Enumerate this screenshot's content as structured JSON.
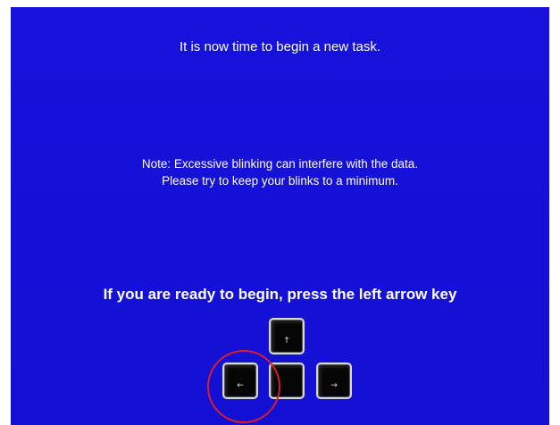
{
  "screen": {
    "background_color": "#1410d8",
    "title": "It is now time to begin a new task.",
    "note_line1": "Note: Excessive blinking can interfere with the data.",
    "note_line2": "Please try to keep your blinks to a minimum.",
    "prompt": "If you are ready to begin, press the left arrow key"
  },
  "keys": {
    "up": {
      "icon": "up-arrow-icon",
      "glyph": "↑"
    },
    "left": {
      "icon": "left-arrow-icon",
      "glyph": "←"
    },
    "down": {
      "icon": "none",
      "glyph": ""
    },
    "right": {
      "icon": "right-arrow-icon",
      "glyph": "→"
    }
  },
  "highlight": {
    "target": "left-arrow-key",
    "color": "#d8202a"
  }
}
